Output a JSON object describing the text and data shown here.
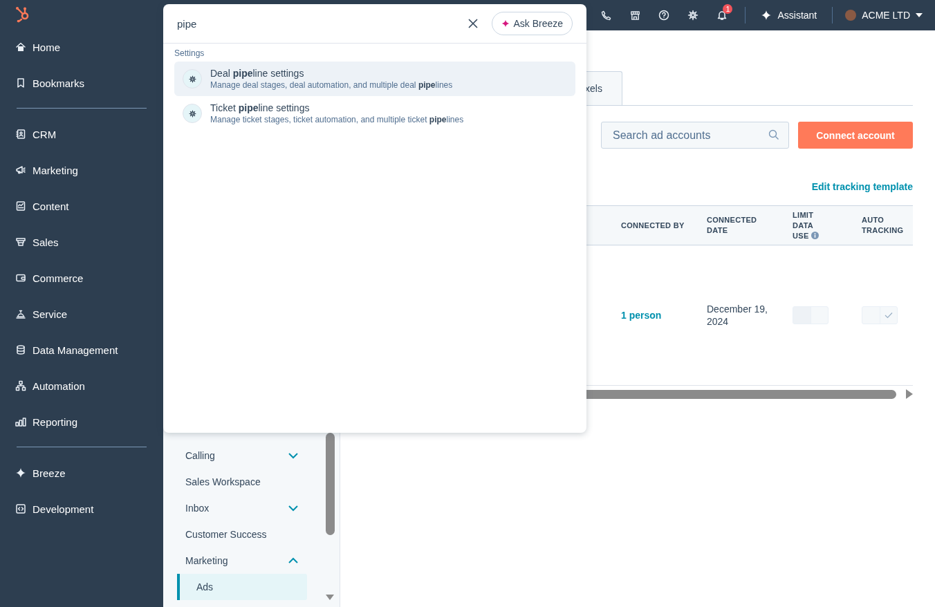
{
  "app_nav": {
    "groups": [
      [
        {
          "label": "Home"
        },
        {
          "label": "Bookmarks"
        }
      ],
      [
        {
          "label": "CRM"
        },
        {
          "label": "Marketing"
        },
        {
          "label": "Content"
        },
        {
          "label": "Sales"
        },
        {
          "label": "Commerce"
        },
        {
          "label": "Service"
        },
        {
          "label": "Data Management"
        },
        {
          "label": "Automation"
        },
        {
          "label": "Reporting"
        }
      ],
      [
        {
          "label": "Breeze"
        },
        {
          "label": "Development"
        }
      ]
    ]
  },
  "top_bar": {
    "notification_count": "1",
    "assistant": "Assistant",
    "account": "ACME LTD"
  },
  "side_nav": {
    "items": [
      {
        "label": "Calling",
        "kind": "group",
        "expanded": false,
        "selected": false
      },
      {
        "label": "Sales Workspace",
        "kind": "link",
        "selected": false
      },
      {
        "label": "Inbox",
        "kind": "group",
        "expanded": false,
        "selected": false
      },
      {
        "label": "Customer Success",
        "kind": "link",
        "selected": false
      },
      {
        "label": "Marketing",
        "kind": "group",
        "expanded": true,
        "selected": false,
        "children": [
          {
            "label": "Ads",
            "selected": true
          }
        ]
      }
    ]
  },
  "main": {
    "tabs": [
      {
        "label": "xels",
        "selected": false
      }
    ],
    "search": {
      "placeholder": "Search ad accounts"
    },
    "connect_button": "Connect account",
    "edit_link": "Edit tracking template",
    "table": {
      "columns": [
        "CONNECTED BY",
        "CONNECTED DATE",
        "LIMIT DATA USE",
        "AUTO TRACKING"
      ],
      "rows": [
        {
          "connected_by": "1 person",
          "connected_date": "December 19, 2024",
          "limit_data_use": false,
          "auto_tracking": true
        }
      ]
    }
  },
  "search_popup": {
    "query": "pipe",
    "ask_button": "Ask Breeze",
    "section": "Settings",
    "results": [
      {
        "title": "Deal **pipe**line settings",
        "description": "Manage deal stages, deal automation, and multiple deal **pipe**lines",
        "selected": true
      },
      {
        "title": "Ticket **pipe**line settings",
        "description": "Manage ticket stages, ticket automation, and multiple ticket **pipe**lines",
        "selected": false
      }
    ]
  }
}
